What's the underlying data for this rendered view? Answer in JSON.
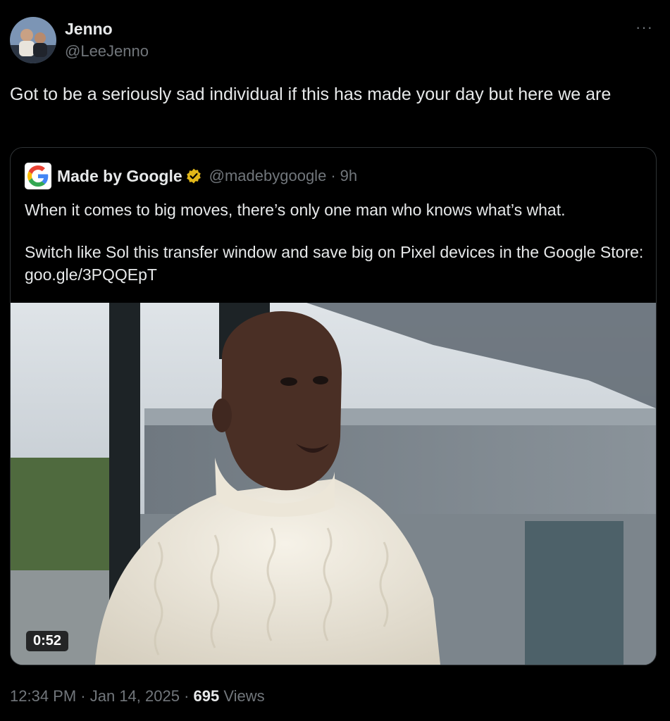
{
  "author": {
    "name": "Jenno",
    "handle": "@LeeJenno",
    "avatar_icon": "profile-photo-avatar"
  },
  "more_icon": "more-dots-icon",
  "more_label": "···",
  "tweet": {
    "text": "Got to be a seriously sad individual if this has made your day but here we are"
  },
  "quoted": {
    "logo_icon": "google-g-logo",
    "name": "Made by Google",
    "badge_icon": "gold-verified-badge-icon",
    "handle": "@madebygoogle",
    "separator": "·",
    "time": "9h",
    "text_line1": "When it comes to big moves, there’s only one man who knows what’s what.",
    "text_line2": "Switch like Sol this transfer window and save big on Pixel devices in the Google Store: goo.gle/3PQQEpT",
    "video_duration": "0:52"
  },
  "meta": {
    "time": "12:34 PM",
    "sep1": " · ",
    "date": "Jan 14, 2025",
    "sep2": " · ",
    "views_count": "695",
    "views_label": " Views"
  },
  "colors": {
    "background": "#000000",
    "text": "#e7e9ea",
    "muted": "#71767b",
    "border": "#2f3336",
    "verified_gold": "#e2b719"
  }
}
